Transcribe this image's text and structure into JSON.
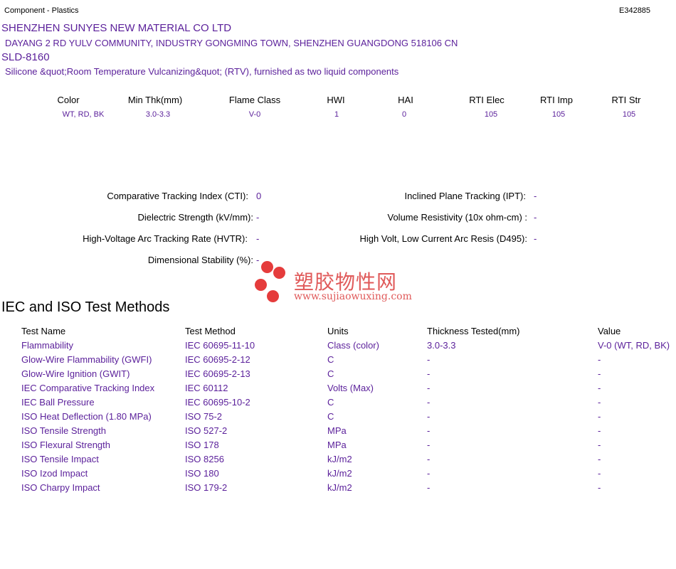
{
  "header": {
    "category": "Component - Plastics",
    "file_number": "E342885"
  },
  "company": {
    "name": "SHENZHEN SUNYES NEW MATERIAL CO LTD",
    "address": "DAYANG 2 RD YULV COMMUNITY, INDUSTRY GONGMING TOWN, SHENZHEN  GUANGDONG  518106 CN",
    "product": "SLD-8160",
    "description": "Silicone &quot;Room Temperature Vulcanizing&quot; (RTV), furnished as two liquid components"
  },
  "ratings": {
    "headers": [
      "Color",
      "Min Thk(mm)",
      "Flame Class",
      "HWI",
      "HAI",
      "RTI Elec",
      "RTI Imp",
      "RTI Str"
    ],
    "values": [
      "WT, RD, BK",
      "3.0-3.3",
      "V-0",
      "1",
      "0",
      "105",
      "105",
      "105"
    ]
  },
  "properties": {
    "left": [
      {
        "label": "Comparative Tracking Index (CTI):",
        "value": "0"
      },
      {
        "label": "Dielectric Strength (kV/mm):",
        "value": "-"
      },
      {
        "label": "High-Voltage Arc Tracking Rate (HVTR):",
        "value": "-"
      },
      {
        "label": "Dimensional Stability (%):",
        "value": "-"
      }
    ],
    "right": [
      {
        "label": "Inclined Plane Tracking (IPT):",
        "value": "-"
      },
      {
        "label": "Volume Resistivity (10x ohm-cm) :",
        "value": "-"
      },
      {
        "label": "High Volt, Low Current Arc Resis (D495):",
        "value": "-"
      }
    ]
  },
  "watermark": {
    "cn": "塑胶物性网",
    "url": "www.sujiaowuxing.com"
  },
  "iec_iso": {
    "title": "IEC and ISO Test Methods",
    "headers": [
      "Test Name",
      "Test Method",
      "Units",
      "Thickness Tested(mm)",
      "Value"
    ],
    "rows": [
      [
        "Flammability",
        "IEC 60695-11-10",
        "Class (color)",
        "3.0-3.3",
        "V-0 (WT, RD, BK)"
      ],
      [
        "Glow-Wire Flammability (GWFI)",
        "IEC 60695-2-12",
        "C",
        "-",
        "-"
      ],
      [
        "Glow-Wire Ignition (GWIT)",
        "IEC 60695-2-13",
        "C",
        "-",
        "-"
      ],
      [
        "IEC Comparative Tracking Index",
        "IEC 60112",
        "Volts (Max)",
        "-",
        "-"
      ],
      [
        "IEC Ball Pressure",
        "IEC 60695-10-2",
        "C",
        "-",
        "-"
      ],
      [
        "ISO Heat Deflection (1.80 MPa)",
        "ISO 75-2",
        "C",
        "-",
        "-"
      ],
      [
        "ISO Tensile Strength",
        "ISO 527-2",
        "MPa",
        "-",
        "-"
      ],
      [
        "ISO Flexural Strength",
        "ISO 178",
        "MPa",
        "-",
        "-"
      ],
      [
        "ISO Tensile Impact",
        "ISO 8256",
        "kJ/m2",
        "-",
        "-"
      ],
      [
        "ISO Izod Impact",
        "ISO 180",
        "kJ/m2",
        "-",
        "-"
      ],
      [
        "ISO Charpy Impact",
        "ISO 179-2",
        "kJ/m2",
        "-",
        "-"
      ]
    ]
  },
  "colors": {
    "text_accent": "#5a1f9a",
    "watermark": "#e53c3c"
  }
}
